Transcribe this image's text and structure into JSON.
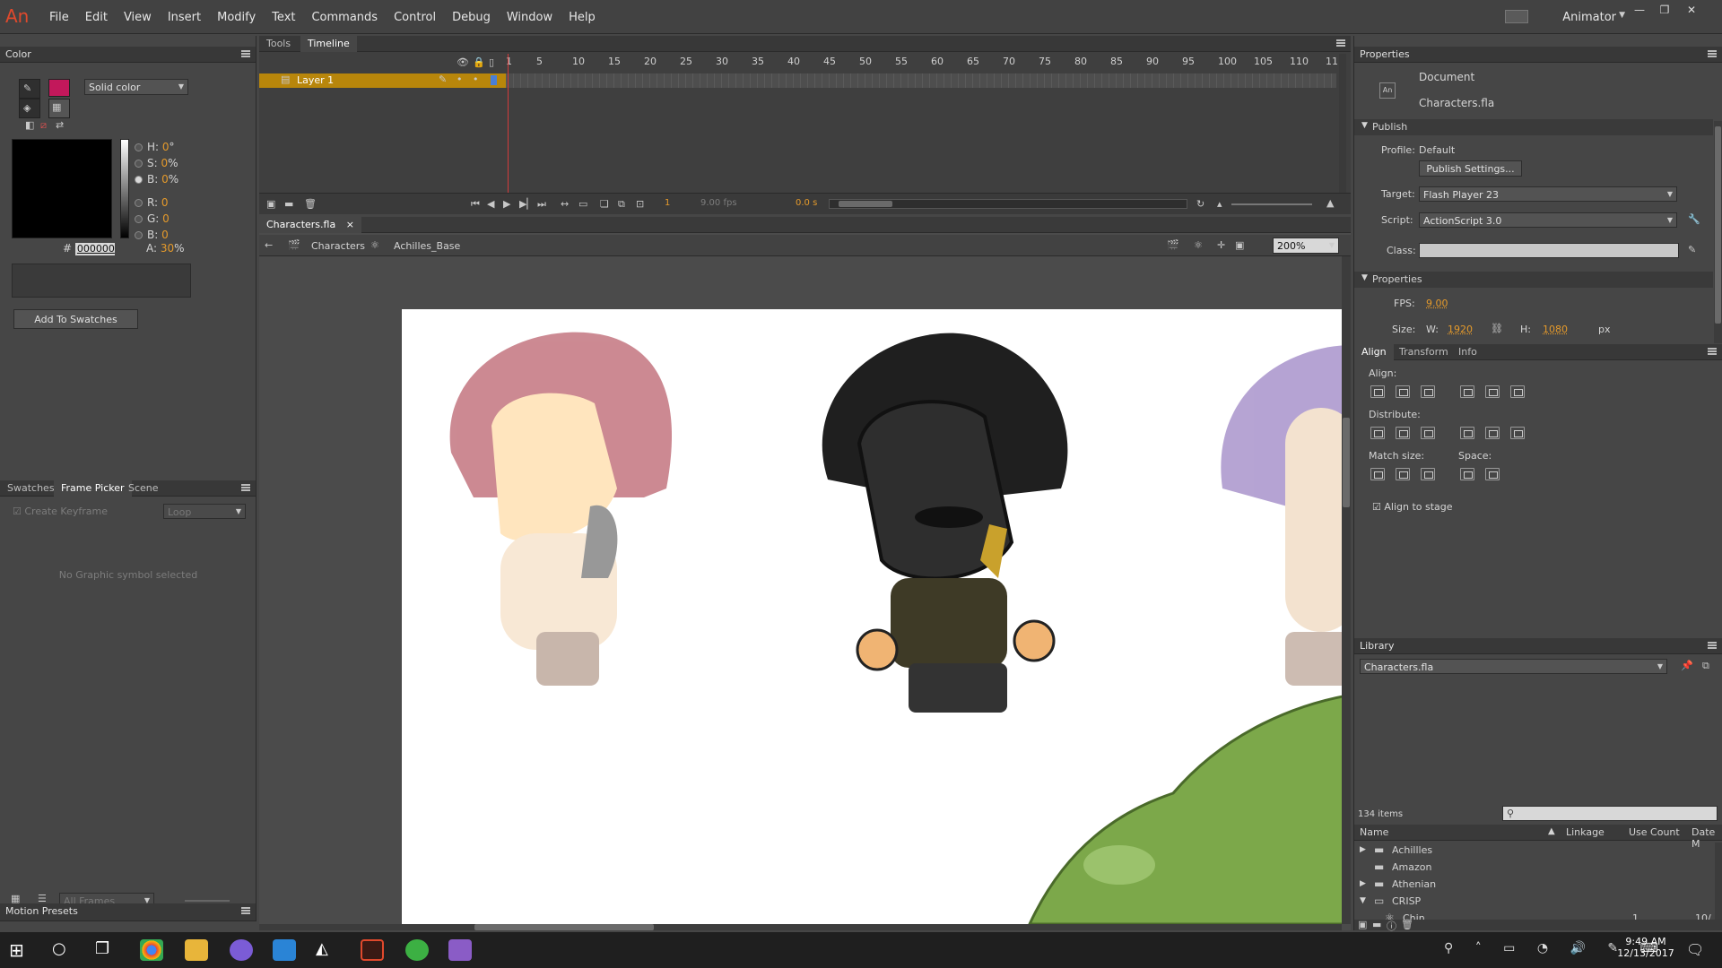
{
  "app": {
    "logo": "An",
    "workspace": "Animator",
    "menu": [
      "File",
      "Edit",
      "View",
      "Insert",
      "Modify",
      "Text",
      "Commands",
      "Control",
      "Debug",
      "Window",
      "Help"
    ]
  },
  "color_panel": {
    "title": "Color",
    "fill_type": "Solid color",
    "stroke_color": "#c2185b",
    "fill_color": "#000000",
    "hsb": [
      {
        "l": "H:",
        "v": "0",
        "u": "°"
      },
      {
        "l": "S:",
        "v": "0",
        "u": "%"
      },
      {
        "l": "B:",
        "v": "0",
        "u": "%"
      }
    ],
    "rgb": [
      {
        "l": "R:",
        "v": "0"
      },
      {
        "l": "G:",
        "v": "0"
      },
      {
        "l": "B:",
        "v": "0"
      }
    ],
    "hex_label": "#",
    "hex": "000000",
    "alpha_label": "A:",
    "alpha": "30",
    "alpha_unit": "%",
    "add_button": "Add To Swatches"
  },
  "lower_left": {
    "tabs": [
      "Swatches",
      "Frame Picker",
      "Scene"
    ],
    "create_keyframe": "Create Keyframe",
    "loop": "Loop",
    "empty": "No Graphic symbol selected",
    "all_frames": "All Frames",
    "motion_presets": "Motion Presets"
  },
  "timeline": {
    "tabs": [
      "Tools",
      "Timeline"
    ],
    "layer": "Layer 1",
    "ruler": [
      "1",
      "5",
      "10",
      "15",
      "20",
      "25",
      "30",
      "35",
      "40",
      "45",
      "50",
      "55",
      "60",
      "65",
      "70",
      "75",
      "80",
      "85",
      "90",
      "95",
      "100",
      "105",
      "110",
      "11"
    ],
    "frame": "1",
    "fps": "9.00 fps",
    "time": "0.0 s"
  },
  "stage": {
    "doc_tab": "Characters.fla",
    "close": "×",
    "scene": "Characters",
    "symbol": "Achilles_Base",
    "zoom": "200%",
    "colors": {
      "red_crest": "#a3293a",
      "purple_crest": "#6d4aa8",
      "helmet_dark": "#2b2b2b",
      "skin": "#f0b473",
      "stage": "#ffffff",
      "monster": "#7ca84a"
    }
  },
  "properties": {
    "title": "Properties",
    "doc_type": "Document",
    "doc_name": "Characters.fla",
    "publish_section": "Publish",
    "profile_label": "Profile:",
    "profile": "Default",
    "publish_settings": "Publish Settings...",
    "target_label": "Target:",
    "target": "Flash Player 23",
    "script_label": "Script:",
    "script": "ActionScript 3.0",
    "class_label": "Class:",
    "props_section": "Properties",
    "fps_label": "FPS:",
    "fps": "9.00",
    "size_label": "Size:",
    "w_label": "W:",
    "w": "1920",
    "h_label": "H:",
    "h": "1080",
    "unit": "px"
  },
  "align": {
    "tabs": [
      "Align",
      "Transform",
      "Info"
    ],
    "align": "Align:",
    "distribute": "Distribute:",
    "match": "Match size:",
    "space": "Space:",
    "stage": "Align to stage"
  },
  "library": {
    "title": "Library",
    "doc": "Characters.fla",
    "count": "134 items",
    "cols": [
      "Name",
      "Linkage",
      "Use Count",
      "Date M"
    ],
    "items": [
      {
        "name": "Achillles",
        "arrow": "▶"
      },
      {
        "name": "Amazon",
        "arrow": ""
      },
      {
        "name": "Athenian",
        "arrow": "▶"
      },
      {
        "name": "CRISP",
        "arrow": "▼"
      },
      {
        "name": "Chin",
        "arrow": "",
        "count": "1",
        "date": "10/"
      }
    ]
  },
  "taskbar": {
    "time": "9:49 AM",
    "date": "12/13/2017"
  }
}
